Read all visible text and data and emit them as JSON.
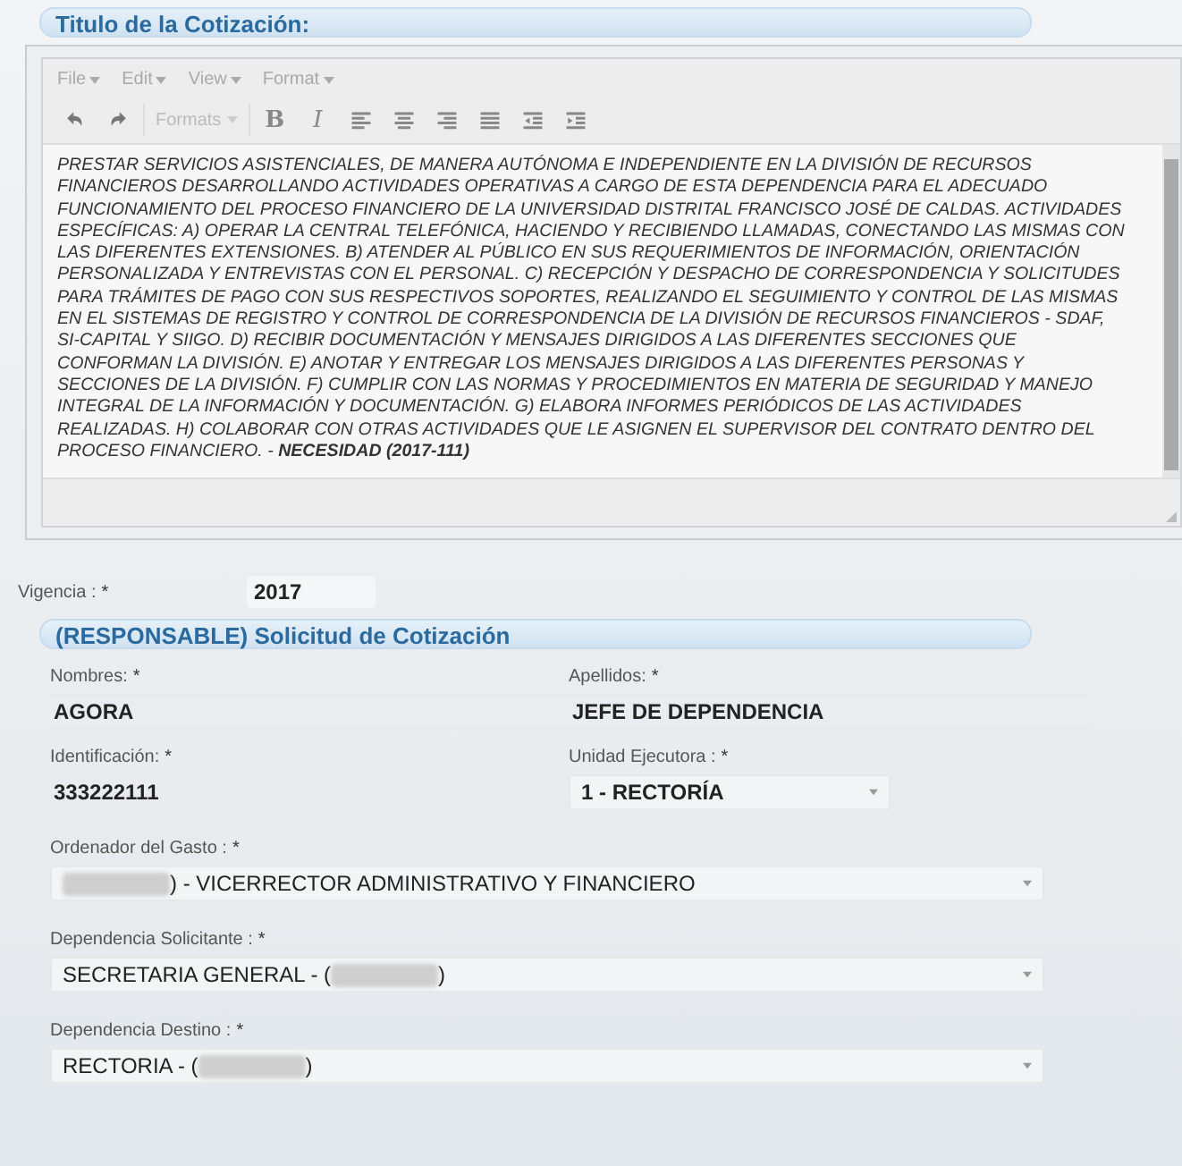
{
  "title_section": {
    "heading": "Titulo de la Cotización:"
  },
  "editor": {
    "menu": [
      "File",
      "Edit",
      "View",
      "Format"
    ],
    "toolbar": [
      {
        "kind": "undo"
      },
      {
        "kind": "redo"
      },
      {
        "kind": "dropdown",
        "label": "Formats"
      },
      {
        "kind": "bold",
        "label": "B"
      },
      {
        "kind": "italic",
        "label": "I"
      },
      {
        "kind": "align-left"
      },
      {
        "kind": "align-center"
      },
      {
        "kind": "align-right"
      },
      {
        "kind": "justify"
      },
      {
        "kind": "outdent"
      },
      {
        "kind": "indent"
      }
    ],
    "content": "PRESTAR SERVICIOS ASISTENCIALES, DE MANERA AUTÓNOMA E INDEPENDIENTE EN LA DIVISIÓN DE RECURSOS FINANCIEROS DESARROLLANDO ACTIVIDADES OPERATIVAS A CARGO DE ESTA DEPENDENCIA PARA EL ADECUADO FUNCIONAMIENTO DEL PROCESO FINANCIERO DE LA UNIVERSIDAD DISTRITAL FRANCISCO JOSÉ DE CALDAS. ACTIVIDADES ESPECÍFICAS: A) OPERAR LA CENTRAL TELEFÓNICA, HACIENDO Y RECIBIENDO LLAMADAS, CONECTANDO LAS MISMAS CON LAS DIFERENTES EXTENSIONES. B) ATENDER AL PÚBLICO EN SUS REQUERIMIENTOS DE INFORMACIÓN, ORIENTACIÓN PERSONALIZADA Y ENTREVISTAS CON EL PERSONAL. C) RECEPCIÓN Y DESPACHO DE CORRESPONDENCIA Y SOLICITUDES PARA TRÁMITES DE PAGO CON SUS RESPECTIVOS SOPORTES, REALIZANDO EL SEGUIMIENTO Y CONTROL DE LAS MISMAS EN EL SISTEMAS DE REGISTRO Y CONTROL DE CORRESPONDENCIA DE LA DIVISIÓN DE RECURSOS FINANCIEROS - SDAF, SI-CAPITAL Y SIIGO. D) RECIBIR DOCUMENTACIÓN Y MENSAJES DIRIGIDOS A LAS DIFERENTES SECCIONES QUE CONFORMAN LA DIVISIÓN. E) ANOTAR Y ENTREGAR LOS MENSAJES DIRIGIDOS A LAS DIFERENTES PERSONAS Y SECCIONES DE LA DIVISIÓN. F) CUMPLIR CON LAS NORMAS Y PROCEDIMIENTOS EN MATERIA DE SEGURIDAD Y MANEJO INTEGRAL DE LA INFORMACIÓN Y DOCUMENTACIÓN. G) ELABORA INFORMES PERIÓDICOS DE LAS ACTIVIDADES REALIZADAS. H) COLABORAR CON OTRAS ACTIVIDADES QUE LE ASIGNEN EL SUPERVISOR DEL CONTRATO DENTRO DEL PROCESO FINANCIERO. - **NECESIDAD (2017-111)**"
  },
  "vigencia": {
    "label": "Vigencia :",
    "required": "*",
    "value": "2017"
  },
  "responsable_section": {
    "heading": "(RESPONSABLE) Solicitud de Cotización",
    "pairs": [
      [
        {
          "label": "Nombres:",
          "required": "*",
          "kind": "text",
          "value": "AGORA"
        },
        {
          "label": "Apellidos:",
          "required": "*",
          "kind": "text",
          "value": "JEFE DE DEPENDENCIA"
        }
      ],
      [
        {
          "label": "Identificación:",
          "required": "*",
          "kind": "text",
          "value": "333222111"
        },
        {
          "label": "Unidad Ejecutora :",
          "required": "*",
          "kind": "select",
          "parts": [
            {
              "kind": "text",
              "text": "1 - RECTORÍA"
            }
          ]
        }
      ]
    ],
    "selects": [
      {
        "label": "Ordenador del Gasto :",
        "required": "*",
        "parts": [
          {
            "kind": "redacted"
          },
          {
            "kind": "text",
            "text": ") - VICERRECTOR ADMINISTRATIVO Y FINANCIERO"
          }
        ]
      },
      {
        "label": "Dependencia Solicitante :",
        "required": "*",
        "parts": [
          {
            "kind": "text",
            "text": "SECRETARIA GENERAL - ("
          },
          {
            "kind": "redacted"
          },
          {
            "kind": "text",
            "text": ")"
          }
        ]
      },
      {
        "label": "Dependencia Destino :",
        "required": "*",
        "parts": [
          {
            "kind": "text",
            "text": "RECTORIA - ("
          },
          {
            "kind": "redacted"
          },
          {
            "kind": "text",
            "text": ")"
          }
        ]
      }
    ]
  }
}
